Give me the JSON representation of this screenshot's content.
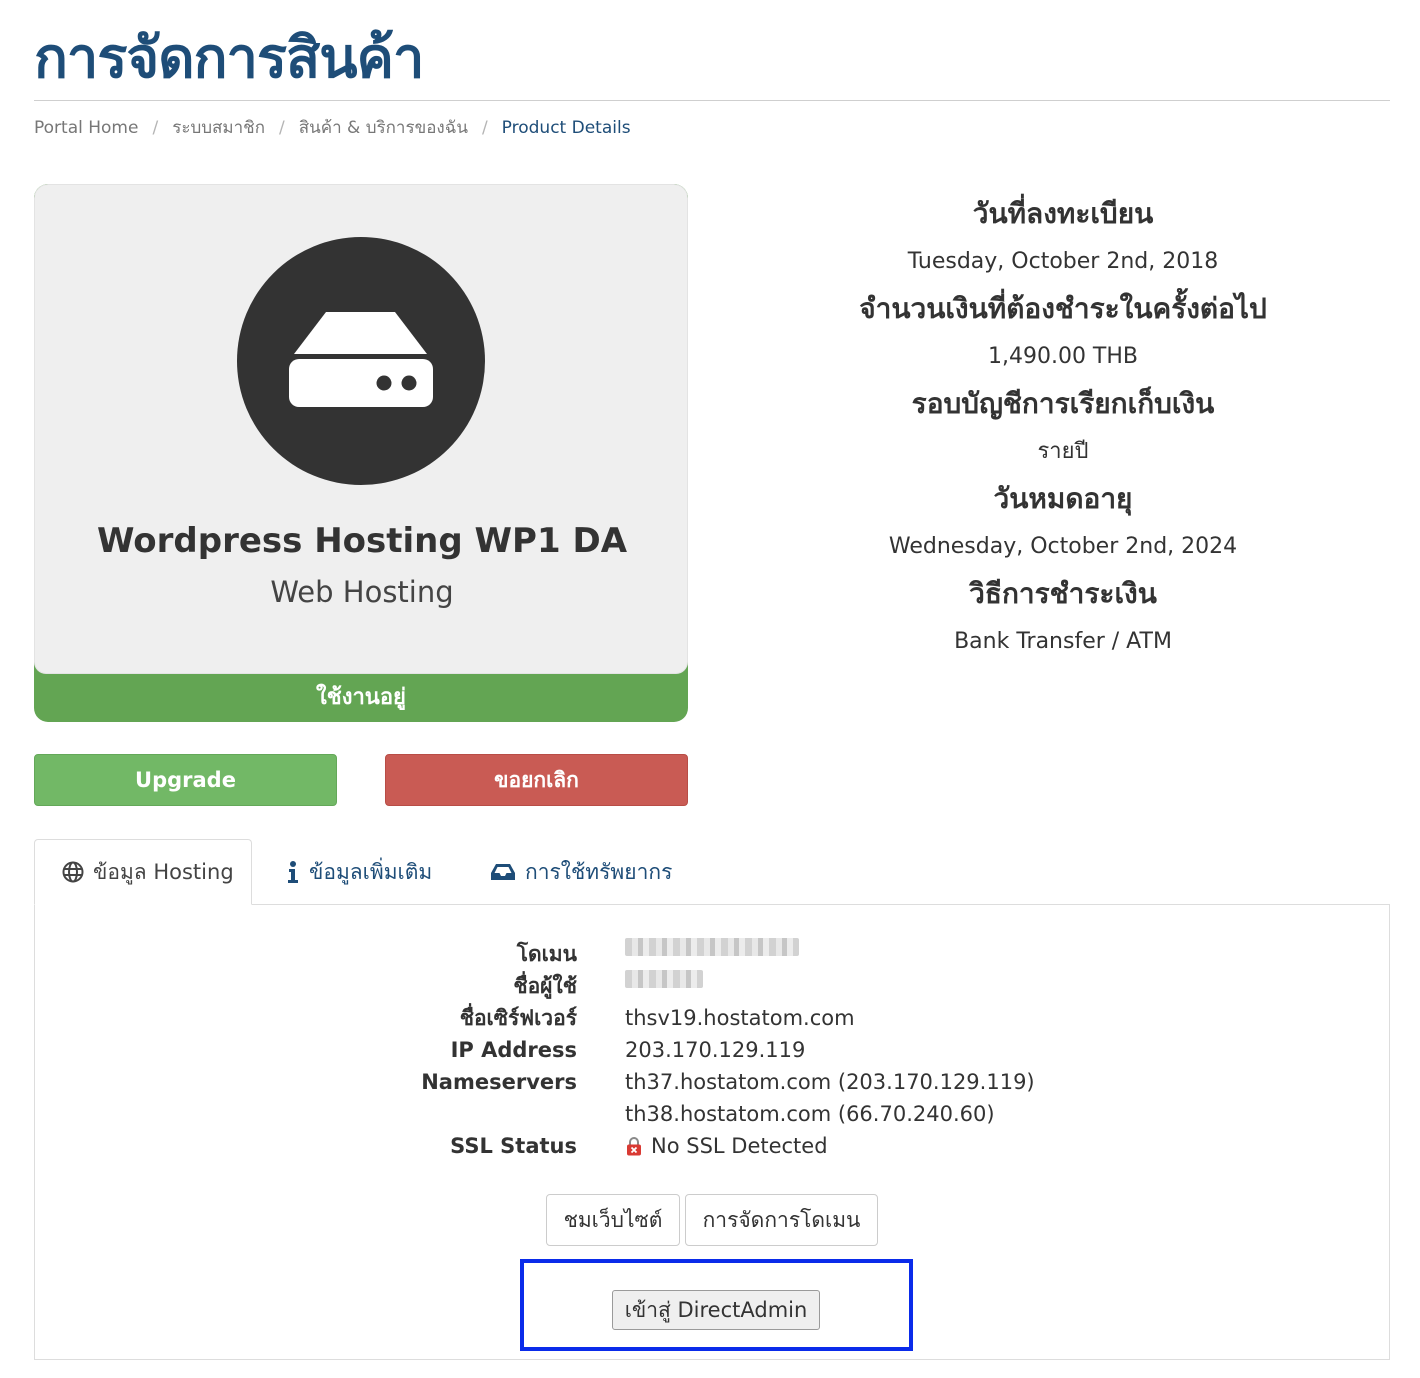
{
  "page": {
    "title": "การจัดการสินค้า"
  },
  "breadcrumb": [
    {
      "label": "Portal Home"
    },
    {
      "label": "ระบบสมาชิก"
    },
    {
      "label": "สินค้า & บริการของฉัน"
    },
    {
      "label": "Product Details"
    }
  ],
  "product": {
    "name": "Wordpress Hosting WP1 DA",
    "group": "Web Hosting",
    "status": "ใช้งานอยู่",
    "icon": "server-icon"
  },
  "actions": {
    "upgrade": "Upgrade",
    "cancel": "ขอยกเลิก"
  },
  "info": {
    "registration_label": "วันที่ลงทะเบียน",
    "registration_value": "Tuesday, October 2nd, 2018",
    "next_due_label": "จำนวนเงินที่ต้องชำระในครั้งต่อไป",
    "next_due_value": "1,490.00 THB",
    "billing_cycle_label": "รอบบัญชีการเรียกเก็บเงิน",
    "billing_cycle_value": "รายปี",
    "expiry_label": "วันหมดอายุ",
    "expiry_value": "Wednesday, October 2nd, 2024",
    "payment_method_label": "วิธีการชำระเงิน",
    "payment_method_value": "Bank Transfer / ATM"
  },
  "tabs": [
    {
      "label": "ข้อมูล Hosting",
      "icon": "globe-icon"
    },
    {
      "label": "ข้อมูลเพิ่มเติม",
      "icon": "info-icon"
    },
    {
      "label": "การใช้ทรัพยากร",
      "icon": "inbox-icon"
    }
  ],
  "hosting": {
    "domain_label": "โดเมน",
    "username_label": "ชื่อผู้ใช้",
    "server_label": "ชื่อเซิร์ฟเวอร์",
    "server_value": "thsv19.hostatom.com",
    "ip_label": "IP Address",
    "ip_value": "203.170.129.119",
    "nameservers_label": "Nameservers",
    "ns1": "th37.hostatom.com (203.170.129.119)",
    "ns2": "th38.hostatom.com (66.70.240.60)",
    "ssl_label": "SSL Status",
    "ssl_value": "No SSL Detected",
    "visit_button": "ชมเว็บไซต์",
    "manage_domain_button": "การจัดการโดเมน",
    "login_button": "เข้าสู่ DirectAdmin"
  },
  "colors": {
    "brand": "#1e4d78",
    "status_active": "#63a553",
    "upgrade": "#72b866",
    "cancel": "#c95b54",
    "highlight": "#0a2bea"
  }
}
